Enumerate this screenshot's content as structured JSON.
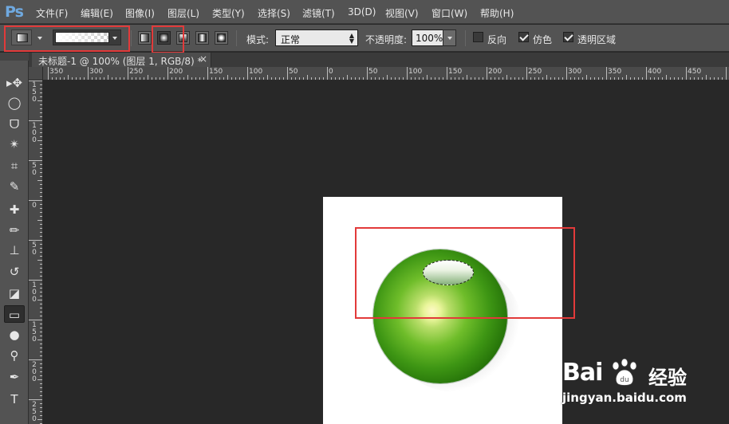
{
  "app": {
    "logo": "Ps"
  },
  "menu": [
    {
      "label": "文件(F)"
    },
    {
      "label": "编辑(E)"
    },
    {
      "label": "图像(I)"
    },
    {
      "label": "图层(L)"
    },
    {
      "label": "类型(Y)"
    },
    {
      "label": "选择(S)"
    },
    {
      "label": "滤镜(T)"
    },
    {
      "label": "3D(D)"
    },
    {
      "label": "视图(V)"
    },
    {
      "label": "窗口(W)"
    },
    {
      "label": "帮助(H)"
    }
  ],
  "options": {
    "tool_preset_icon": "gradient-tool-icon",
    "gradient_types": [
      "linear-gradient",
      "radial-gradient",
      "angle-gradient",
      "reflected-gradient",
      "diamond-gradient"
    ],
    "active_gradient_type": "radial-gradient",
    "mode_label": "模式:",
    "mode_value": "正常",
    "opacity_label": "不透明度:",
    "opacity_value": "100%",
    "reverse_label": "反向",
    "reverse_checked": false,
    "dither_label": "仿色",
    "dither_checked": true,
    "transparency_label": "透明区域",
    "transparency_checked": true
  },
  "document": {
    "tab_title": "未标题-1 @ 100% (图层 1, RGB/8) *",
    "close_glyph": "×"
  },
  "ruler": {
    "top_labels": [
      "350",
      "300",
      "250",
      "200",
      "150",
      "100",
      "50",
      "0",
      "50",
      "100",
      "150",
      "200",
      "250",
      "300",
      "350",
      "400",
      "450"
    ],
    "left_labels": [
      [
        "1",
        "5",
        "0"
      ],
      [
        "1",
        "0",
        "0"
      ],
      [
        "5",
        "0"
      ],
      [
        "0"
      ],
      [
        "5",
        "0"
      ],
      [
        "1",
        "0",
        "0"
      ],
      [
        "1",
        "5",
        "0"
      ],
      [
        "2",
        "0",
        "0"
      ],
      [
        "2",
        "5",
        "0"
      ]
    ]
  },
  "tools": [
    {
      "name": "move-tool-icon",
      "glyph": "▸✥"
    },
    {
      "name": "marquee-tool-icon",
      "glyph": "◯"
    },
    {
      "name": "lasso-tool-icon",
      "glyph": "ᗜ"
    },
    {
      "name": "magic-wand-tool-icon",
      "glyph": "✴"
    },
    {
      "name": "crop-tool-icon",
      "glyph": "⌗"
    },
    {
      "name": "eyedropper-tool-icon",
      "glyph": "✎"
    },
    {
      "name": "healing-brush-tool-icon",
      "glyph": "✚"
    },
    {
      "name": "brush-tool-icon",
      "glyph": "✏"
    },
    {
      "name": "clone-stamp-tool-icon",
      "glyph": "⊥"
    },
    {
      "name": "history-brush-tool-icon",
      "glyph": "↺"
    },
    {
      "name": "eraser-tool-icon",
      "glyph": "◪"
    },
    {
      "name": "gradient-tool-icon",
      "glyph": "▭"
    },
    {
      "name": "blur-tool-icon",
      "glyph": "●"
    },
    {
      "name": "dodge-tool-icon",
      "glyph": "⚲"
    },
    {
      "name": "pen-tool-icon",
      "glyph": "✒"
    },
    {
      "name": "type-tool-icon",
      "glyph": "T"
    }
  ],
  "watermark": {
    "logo": "Bai",
    "cn": "经验",
    "url": "jingyan.baidu.com"
  },
  "colors": {
    "highlight": "#e23a3a",
    "ball_green": "#3e9614",
    "chrome": "#535353"
  }
}
